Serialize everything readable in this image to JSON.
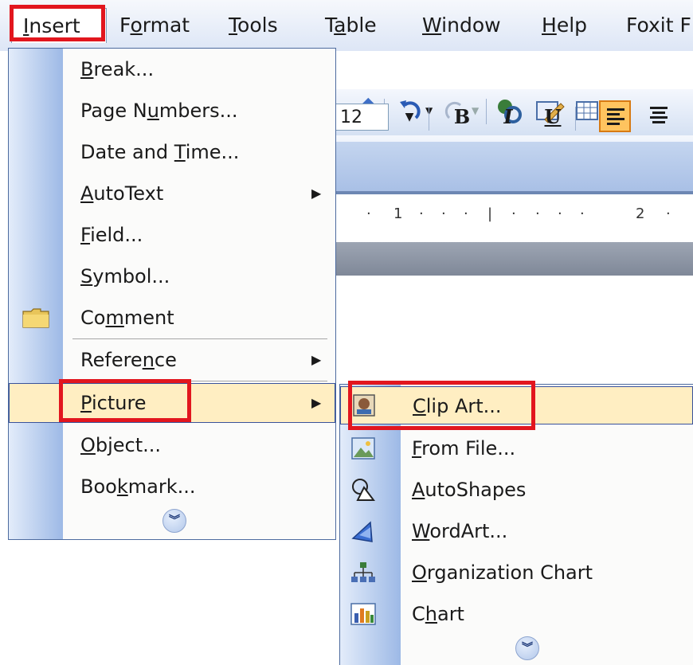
{
  "menubar": {
    "items": [
      {
        "label": "Insert",
        "mnemonic": "I"
      },
      {
        "label": "Format",
        "mnemonic": "o"
      },
      {
        "label": "Tools",
        "mnemonic": "T"
      },
      {
        "label": "Table",
        "mnemonic": "a"
      },
      {
        "label": "Window",
        "mnemonic": "W"
      },
      {
        "label": "Help",
        "mnemonic": "H"
      },
      {
        "label": "Foxit F"
      }
    ]
  },
  "toolbar": {
    "font_size": "12",
    "bold": "B",
    "italic": "I",
    "underline": "U"
  },
  "ruler": {
    "marks": [
      "1",
      "2"
    ]
  },
  "insert_menu": {
    "items": [
      {
        "label": "Break...",
        "pre": "",
        "key": "B",
        "post": "reak..."
      },
      {
        "label": "Page Numbers...",
        "pre": "Page N",
        "key": "u",
        "post": "mbers..."
      },
      {
        "label": "Date and Time...",
        "pre": "Date and ",
        "key": "T",
        "post": "ime..."
      },
      {
        "label": "AutoText",
        "pre": "",
        "key": "A",
        "post": "utoText",
        "submenu": true
      },
      {
        "label": "Field...",
        "pre": "",
        "key": "F",
        "post": "ield..."
      },
      {
        "label": "Symbol...",
        "pre": "",
        "key": "S",
        "post": "ymbol..."
      },
      {
        "label": "Comment",
        "pre": "Co",
        "key": "m",
        "post": "ment",
        "icon": "folder-icon"
      },
      {
        "label": "Reference",
        "pre": "Refere",
        "key": "n",
        "post": "ce",
        "submenu": true
      },
      {
        "label": "Picture",
        "pre": "",
        "key": "P",
        "post": "icture",
        "submenu": true,
        "highlighted": true
      },
      {
        "label": "Object...",
        "pre": "",
        "key": "O",
        "post": "bject..."
      },
      {
        "label": "Bookmark...",
        "pre": "Boo",
        "key": "k",
        "post": "mark..."
      }
    ]
  },
  "picture_submenu": {
    "items": [
      {
        "label": "Clip Art...",
        "pre": "",
        "key": "C",
        "post": "lip Art...",
        "icon": "clip-art-icon",
        "highlighted": true
      },
      {
        "label": "From File...",
        "pre": "",
        "key": "F",
        "post": "rom File...",
        "icon": "picture-file-icon"
      },
      {
        "label": "AutoShapes",
        "pre": "",
        "key": "A",
        "post": "utoShapes",
        "icon": "autoshapes-icon"
      },
      {
        "label": "WordArt...",
        "pre": "",
        "key": "W",
        "post": "ordArt...",
        "icon": "wordart-icon"
      },
      {
        "label": "Organization Chart",
        "pre": "",
        "key": "O",
        "post": "rganization Chart",
        "icon": "org-chart-icon"
      },
      {
        "label": "Chart",
        "pre": "C",
        "key": "h",
        "post": "art",
        "icon": "chart-icon"
      }
    ]
  },
  "colors": {
    "highlight_box": "#e2161e",
    "hover_fill": "#ffeec2",
    "menu_border": "#4d6b9f"
  }
}
